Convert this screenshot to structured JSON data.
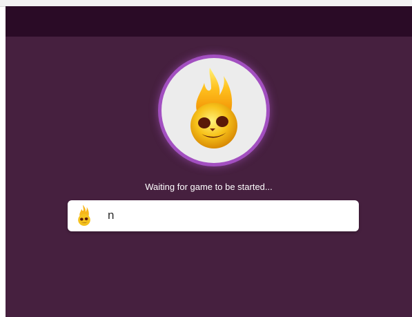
{
  "lobby": {
    "status": "Waiting for game to be started..."
  },
  "avatar": {
    "icon": "fire-skull-icon",
    "ring_color": "#a24fc0"
  },
  "players": [
    {
      "name": "n",
      "icon": "fire-skull-icon"
    }
  ],
  "colors": {
    "background": "#46203f",
    "header": "#2a0b26",
    "card": "#ffffff"
  }
}
